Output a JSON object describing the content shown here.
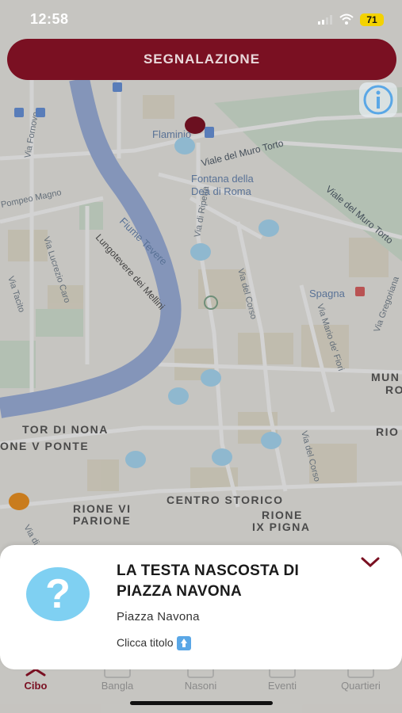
{
  "status_bar": {
    "time": "12:58",
    "battery": "71"
  },
  "header": {
    "report_button": "SEGNALAZIONE"
  },
  "map": {
    "labels": {
      "via_fornovo": "Via Fornovo",
      "flaminio": "Flaminio",
      "viale_muro_torto": "Viale del Muro Torto",
      "viale_muro_torto_2": "Viale del Muro Torto",
      "fontana_1": "Fontana della",
      "fontana_2": "Dea di Roma",
      "pompeo_magno": "Pompeo Magno",
      "fiume_tevere": "Fiume Tevere",
      "lungotevere": "Lungotevere dei Mellini",
      "via_lucrezio_caro": "Via Lucrezio Caro",
      "via_tacito": "Via Tacito",
      "via_ripetta": "Via di Ripetta",
      "via_corso": "Via del Corso",
      "via_corso_2": "Via del Corso",
      "spagna": "Spagna",
      "via_mario_fiori": "Via Mario de' Fiori",
      "via_gregoriana": "Via Gregoriana",
      "tor_di_nona": "TOR DI NONA",
      "rione_v_ponte": "ONE V PONTE",
      "rione_vi": "RIONE VI",
      "parione": "PARIONE",
      "centro_storico": "CENTRO STORICO",
      "rione": "RIONE",
      "ix_pigna": "IX PIGNA",
      "mun": "MUN",
      "ro": "RO",
      "rio": "RIO",
      "via_di_m": "Via di M"
    }
  },
  "detail_card": {
    "title": "LA TESTA NASCOSTA DI PIAZZA NAVONA",
    "subtitle": "Piazza Navona",
    "hint": "Clicca titolo"
  },
  "tabs": [
    {
      "label": "Cibo",
      "active": true
    },
    {
      "label": "Bangla",
      "active": false
    },
    {
      "label": "Nasoni",
      "active": false
    },
    {
      "label": "Eventi",
      "active": false
    },
    {
      "label": "Quartieri",
      "active": false
    }
  ],
  "colors": {
    "brand": "#7a1022",
    "marker_blue": "#8fb8cf",
    "marker_orange": "#c97c1d",
    "question_icon": "#7fd0f2"
  },
  "icons": {
    "info": "info-icon",
    "question": "question-mark-icon",
    "collapse": "chevron-down-icon",
    "hint": "arrow-up-square-icon"
  }
}
